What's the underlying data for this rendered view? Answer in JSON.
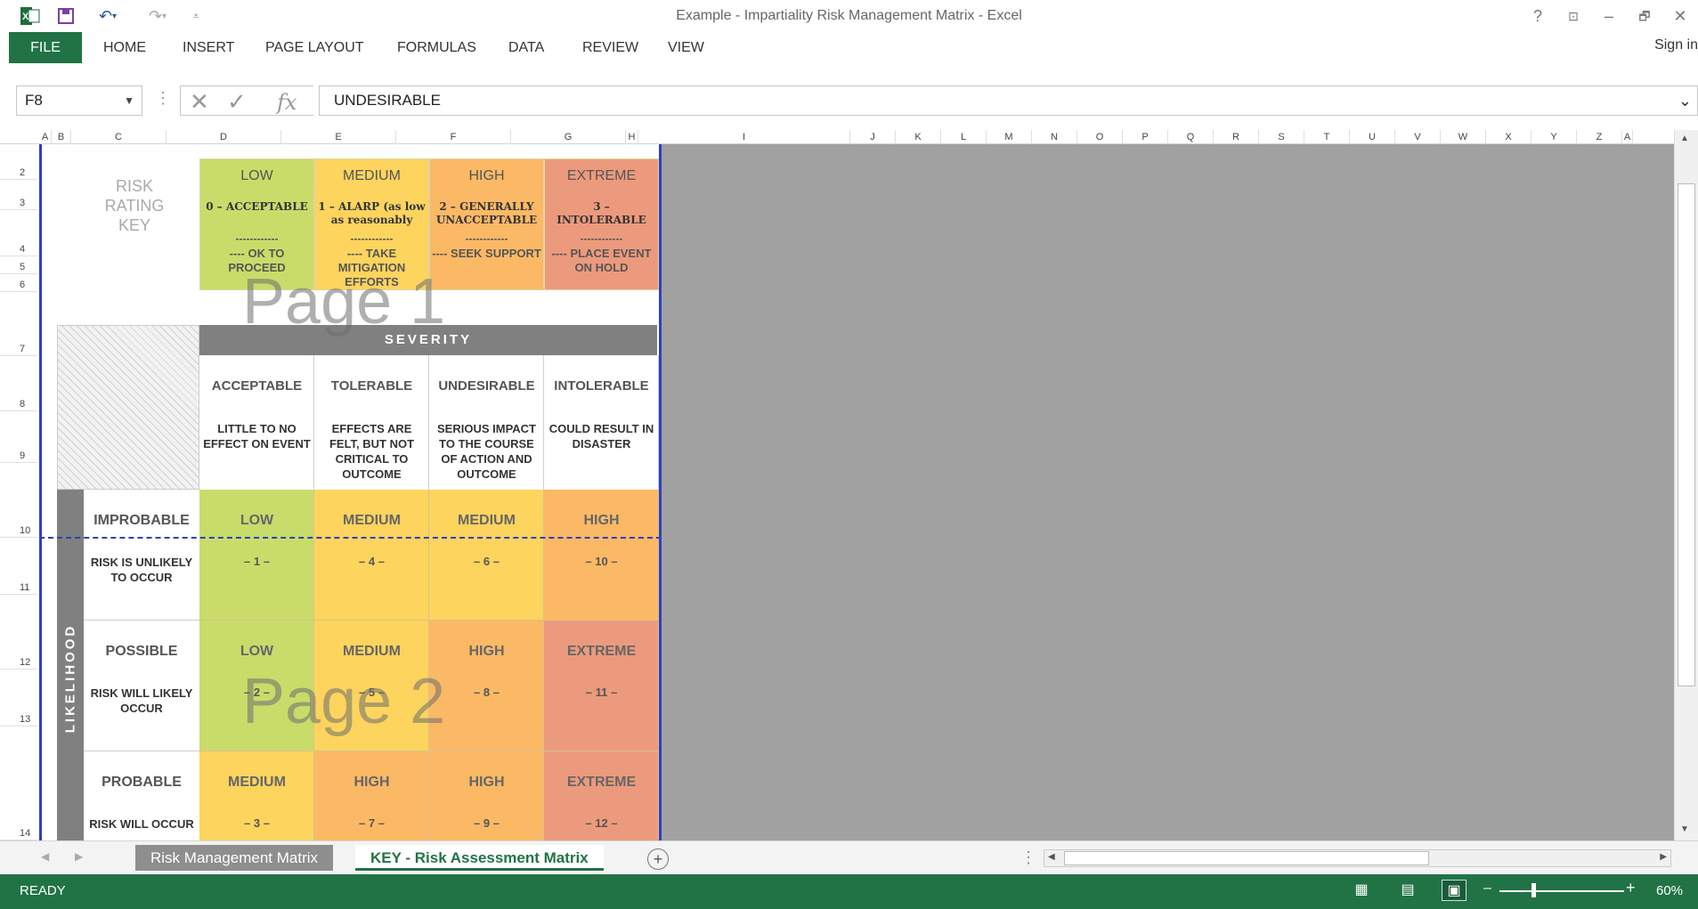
{
  "window": {
    "title": "Example - Impartiality Risk Management Matrix - Excel",
    "help": "?",
    "controls": [
      "–",
      "🗗",
      "✕"
    ]
  },
  "ribbon": {
    "file": "FILE",
    "tabs": [
      "HOME",
      "INSERT",
      "PAGE LAYOUT",
      "FORMULAS",
      "DATA",
      "REVIEW",
      "VIEW"
    ],
    "signin": "Sign in"
  },
  "formula_bar": {
    "name_box": "F8",
    "value": "UNDESIRABLE"
  },
  "columns": [
    "A",
    "B",
    "C",
    "D",
    "E",
    "F",
    "G",
    "H",
    "I",
    "J",
    "K",
    "L",
    "M",
    "N",
    "O",
    "P",
    "Q",
    "R",
    "S",
    "T",
    "U",
    "V",
    "W",
    "X",
    "Y",
    "Z",
    "A"
  ],
  "rows": [
    "2",
    "3",
    "4",
    "5",
    "6",
    "7",
    "8",
    "9",
    "10",
    "11",
    "12",
    "13",
    "14"
  ],
  "key": {
    "label": "RISK RATING KEY",
    "items": [
      {
        "title": "LOW",
        "sub": "0 – ACCEPTABLE",
        "action": "---- OK TO PROCEED",
        "color": "#c9dc6a"
      },
      {
        "title": "MEDIUM",
        "sub": "1 – ALARP (as low as reasonably",
        "action": "---- TAKE MITIGATION EFFORTS",
        "color": "#fcd45e"
      },
      {
        "title": "HIGH",
        "sub": "2 – GENERALLY UNACCEPTABLE",
        "action": "---- SEEK SUPPORT",
        "color": "#fbb966"
      },
      {
        "title": "EXTREME",
        "sub": "3 – INTOLERABLE",
        "action": "---- PLACE EVENT ON HOLD",
        "color": "#ec9a7d"
      }
    ],
    "dash": "------------"
  },
  "severity": {
    "header": "SEVERITY",
    "columns": [
      {
        "title": "ACCEPTABLE",
        "desc": "LITTLE TO NO EFFECT ON EVENT"
      },
      {
        "title": "TOLERABLE",
        "desc": "EFFECTS ARE FELT, BUT NOT CRITICAL TO OUTCOME"
      },
      {
        "title": "UNDESIRABLE",
        "desc": "SERIOUS IMPACT TO THE COURSE OF ACTION AND OUTCOME"
      },
      {
        "title": "INTOLERABLE",
        "desc": "COULD RESULT IN DISASTER"
      }
    ]
  },
  "likelihood": {
    "header": "LIKELIHOOD",
    "rows": [
      {
        "title": "IMPROBABLE",
        "desc": "RISK IS UNLIKELY TO OCCUR",
        "cells": [
          {
            "level": "LOW",
            "score": "– 1 –",
            "color": "#c9dc6a"
          },
          {
            "level": "MEDIUM",
            "score": "– 4 –",
            "color": "#fcd45e"
          },
          {
            "level": "MEDIUM",
            "score": "– 6 –",
            "color": "#fcd45e"
          },
          {
            "level": "HIGH",
            "score": "– 10 –",
            "color": "#fbb966"
          }
        ]
      },
      {
        "title": "POSSIBLE",
        "desc": "RISK WILL LIKELY OCCUR",
        "cells": [
          {
            "level": "LOW",
            "score": "– 2 –",
            "color": "#c9dc6a"
          },
          {
            "level": "MEDIUM",
            "score": "– 5 –",
            "color": "#fcd45e"
          },
          {
            "level": "HIGH",
            "score": "– 8 –",
            "color": "#fbb966"
          },
          {
            "level": "EXTREME",
            "score": "– 11 –",
            "color": "#ec9a7d"
          }
        ]
      },
      {
        "title": "PROBABLE",
        "desc": "RISK WILL OCCUR",
        "cells": [
          {
            "level": "MEDIUM",
            "score": "– 3 –",
            "color": "#fcd45e"
          },
          {
            "level": "HIGH",
            "score": "– 7 –",
            "color": "#fbb966"
          },
          {
            "level": "HIGH",
            "score": "– 9 –",
            "color": "#fbb966"
          },
          {
            "level": "EXTREME",
            "score": "– 12 –",
            "color": "#ec9a7d"
          }
        ]
      }
    ]
  },
  "watermarks": {
    "page1": "Page 1",
    "page2": "Page 2"
  },
  "sheets": {
    "inactive": "Risk Management Matrix",
    "active": "KEY - Risk Assessment Matrix"
  },
  "status": {
    "mode": "READY",
    "zoom": "60%"
  }
}
